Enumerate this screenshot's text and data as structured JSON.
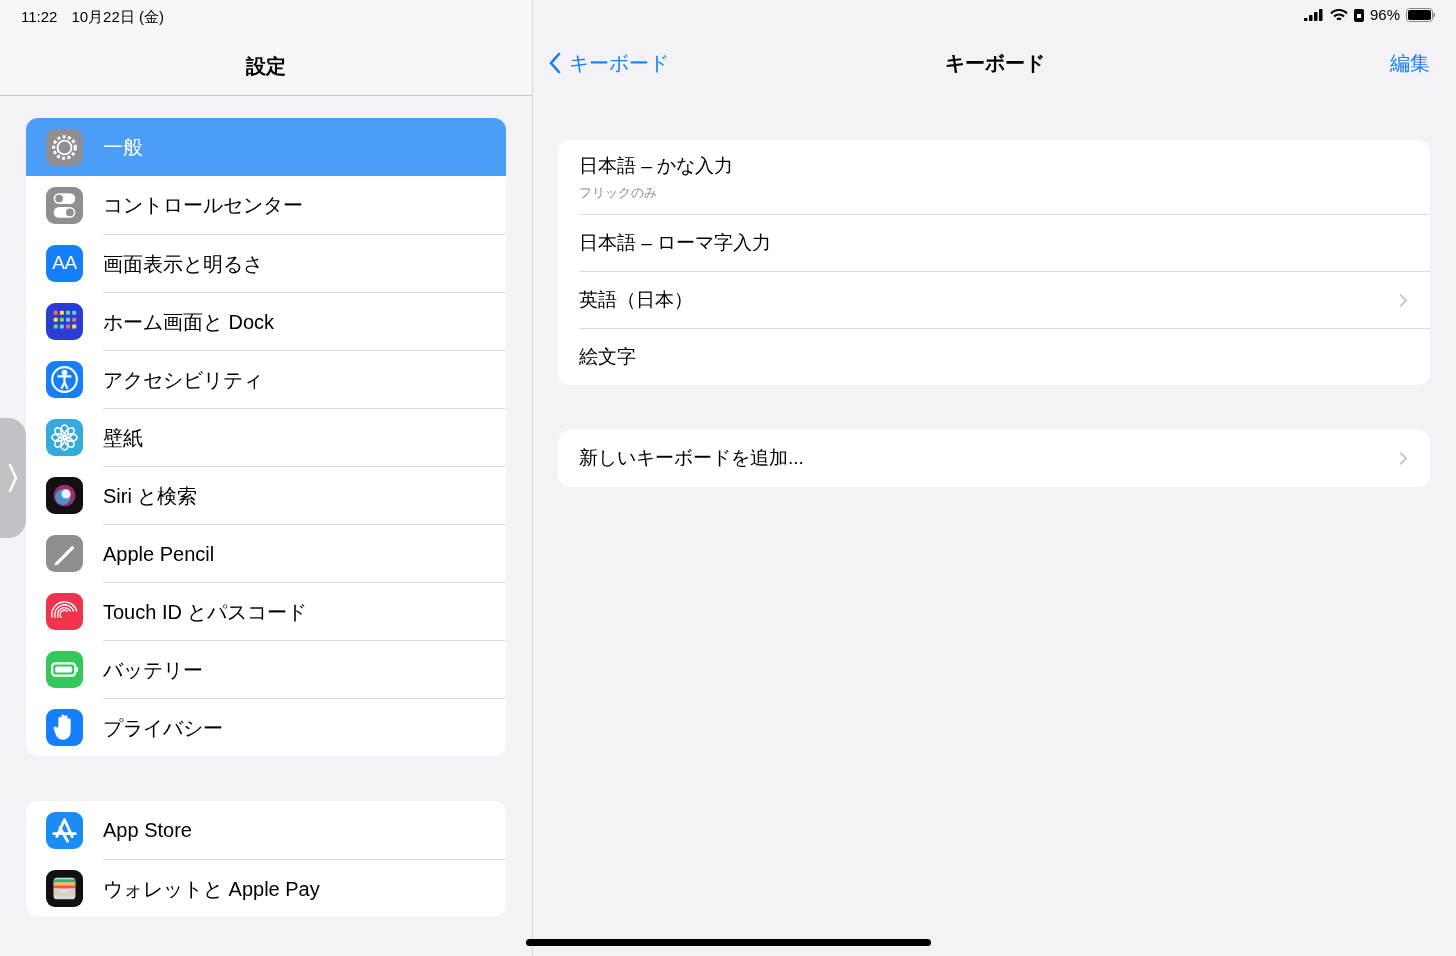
{
  "status_bar": {
    "time": "11:22",
    "date": "10月22日 (金)",
    "battery": "96%"
  },
  "sidebar": {
    "title": "設定",
    "groups": [
      {
        "items": [
          {
            "label": "一般",
            "kind": "gear",
            "selected": true
          },
          {
            "label": "コントロールセンター",
            "kind": "toggles",
            "selected": false
          },
          {
            "label": "画面表示と明るさ",
            "kind": "text",
            "icon_text": "AA",
            "selected": false
          },
          {
            "label": "ホーム画面と Dock",
            "kind": "grid",
            "selected": false
          },
          {
            "label": "アクセシビリティ",
            "kind": "accessibility",
            "selected": false
          },
          {
            "label": "壁紙",
            "kind": "flower",
            "selected": false
          },
          {
            "label": "Siri と検索",
            "kind": "siri",
            "selected": false
          },
          {
            "label": "Apple Pencil",
            "kind": "pencil",
            "selected": false
          },
          {
            "label": "Touch ID とパスコード",
            "kind": "fingerprint",
            "selected": false
          },
          {
            "label": "バッテリー",
            "kind": "battery",
            "selected": false
          },
          {
            "label": "プライバシー",
            "kind": "hand",
            "selected": false
          }
        ]
      },
      {
        "items": [
          {
            "label": "App Store",
            "kind": "appstore",
            "selected": false
          },
          {
            "label": "ウォレットと Apple Pay",
            "kind": "wallet",
            "selected": false
          }
        ]
      }
    ]
  },
  "detail": {
    "back": "キーボード",
    "title": "キーボード",
    "edit": "編集",
    "groups": [
      {
        "rows": [
          {
            "label": "日本語 – かな入力",
            "subtitle": "フリックのみ",
            "chevron": false
          },
          {
            "label": "日本語 – ローマ字入力",
            "chevron": false
          },
          {
            "label": "英語（日本）",
            "chevron": true
          },
          {
            "label": "絵文字",
            "chevron": false
          }
        ]
      },
      {
        "rows": [
          {
            "label": "新しいキーボードを追加...",
            "chevron": true
          }
        ]
      }
    ]
  }
}
